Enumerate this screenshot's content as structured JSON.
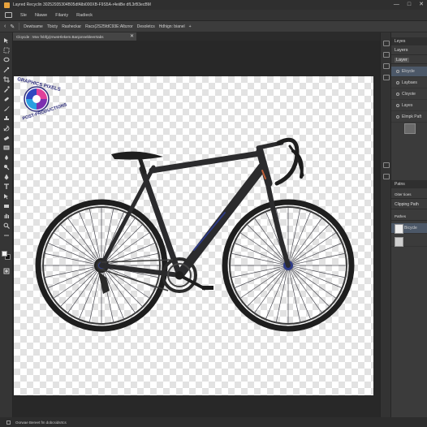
{
  "titlebar": {
    "title": "Layred Recyclin 30252935304B05dfAlbi000XB‑F9S5A‑r4eiiBe dfL3rB3ecBM",
    "minimize": "—",
    "maximize": "□",
    "close": "✕"
  },
  "menubar": {
    "items": [
      "Sle",
      "Niawe",
      "Filaniy",
      "Radieck"
    ]
  },
  "optionsbar": {
    "items": [
      "Dewtsame",
      "Tbicty",
      "Rasheckar",
      "Racs(2S25fdC93E:Albzror",
      "Desoletcs",
      "Hdhign: bianel"
    ],
    "add": "+"
  },
  "document_tab": {
    "label": "Cloycde : Mxv fnbf(p)rnwsHlekem.Banjonnebleerrtabs",
    "close": "✕"
  },
  "logo": {
    "top_text": "GRAPHICS PIXELS",
    "bottom_text": "POST-PRODUCTIONS"
  },
  "layers_panel": {
    "tab_label": "Leyes",
    "title": "Layers",
    "kind_label": "Layer",
    "items": [
      {
        "label": "Elcycle"
      },
      {
        "label": "Laybaes"
      },
      {
        "label": "Cloyote"
      },
      {
        "label": "Layes"
      },
      {
        "label": "Elmpk Paft"
      }
    ]
  },
  "paths_panel": {
    "tab_label": "Patns",
    "sub_label": "Oiter tioes",
    "clipping_label": "Clipping Path",
    "kind_label": "Pathes",
    "items": [
      {
        "label": "Bicycle"
      },
      {
        "label": ""
      }
    ]
  },
  "statusbar": {
    "text": "Oorwae Bereet fm dobcsidsrtcs"
  },
  "colors": {
    "accent": "#e8a33d",
    "bike_frame": "#2b2b2d",
    "bike_accent": "#2e3b86"
  }
}
